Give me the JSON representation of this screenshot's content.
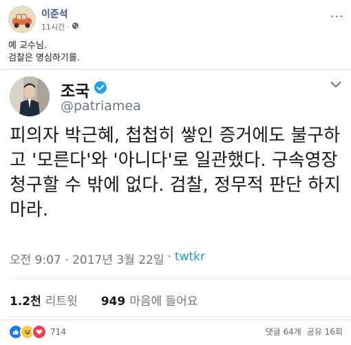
{
  "post": {
    "author": "이준석",
    "time": "11시간",
    "separator": "·",
    "caption_lines": [
      "예 교수님.",
      "검찰은 명심하기를."
    ],
    "more_label": "···"
  },
  "tweet": {
    "name": "조국",
    "handle": "@patriamea",
    "body": "피의자 박근혜, 첩첩히 쌓인 증거에도 불구하고 '모른다'와 '아니다'로 일관했다. 구속영장 청구할 수 밖에 없다. 검찰, 정무적 판단 하지 마라.",
    "time": "오전 9:07 · 2017년 3월 22일",
    "source": "twtkr",
    "retweets_count": "1.2천",
    "retweets_label": "리트윗",
    "likes_count": "949",
    "likes_label": "마음에 들어요"
  },
  "footer": {
    "reaction_count": "714",
    "comments": "댓글 64개",
    "shares": "공유 16회"
  },
  "colors": {
    "link": "#385898",
    "twitter_blue": "#1b95e0",
    "like_blue": "#1877f2",
    "love_red": "#f33e58",
    "haha_yellow": "#f7c94b"
  }
}
